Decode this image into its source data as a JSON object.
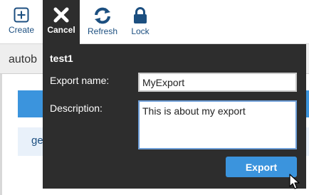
{
  "toolbar": {
    "create_label": "Create",
    "cancel_label": "Cancel",
    "refresh_label": "Refresh",
    "lock_label": "Lock"
  },
  "background": {
    "bar_text": "autob",
    "row_text": "ge"
  },
  "dialog": {
    "title": "test1",
    "export_name_label": "Export name:",
    "export_name_value": "MyExport",
    "description_label": "Description:",
    "description_value": "This is about my export",
    "export_button": "Export"
  },
  "colors": {
    "accent": "#3b94dd",
    "dialog_bg": "#2d2d2d",
    "toolbar_icon": "#1c4f80"
  },
  "icons": [
    "plus-square-icon",
    "close-icon",
    "refresh-icon",
    "lock-icon",
    "mouse-cursor-icon"
  ]
}
